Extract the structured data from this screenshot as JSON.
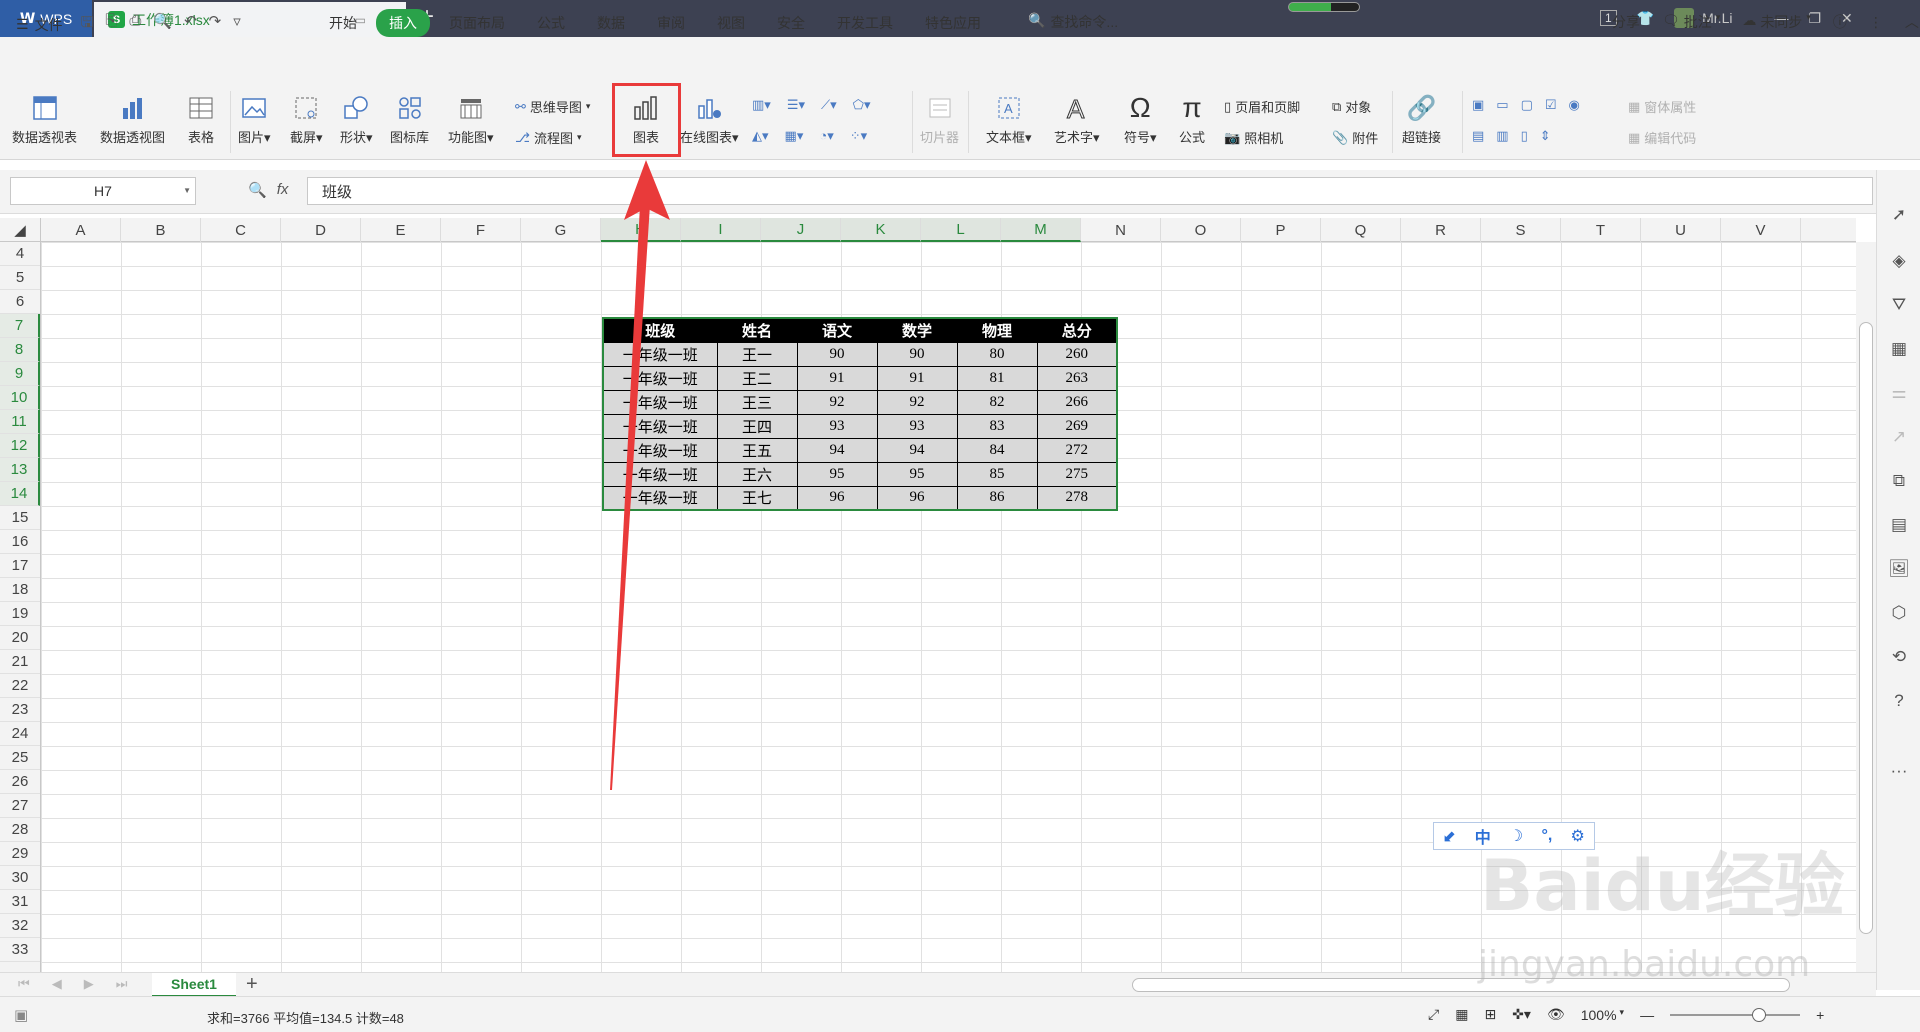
{
  "titlebar": {
    "app_tab": "WPS",
    "doc_tab": "工作簿1.xlsx",
    "window_count": "1",
    "user": "Mr.Li"
  },
  "menu": {
    "file": "文件",
    "tabs": [
      "开始",
      "插入",
      "页面布局",
      "公式",
      "数据",
      "审阅",
      "视图",
      "安全",
      "开发工具",
      "特色应用"
    ],
    "active_tab": "插入",
    "search": "查找命令...",
    "share": "分享",
    "comment": "批注",
    "sync": "未同步"
  },
  "ribbon": {
    "pivot_table": "数据透视表",
    "pivot_chart": "数据透视图",
    "table": "表格",
    "picture": "图片",
    "screenshot": "截屏",
    "shapes": "形状",
    "icon_lib": "图标库",
    "func_chart": "功能图",
    "mindmap": "思维导图",
    "flowchart": "流程图",
    "chart": "图表",
    "online_chart": "在线图表",
    "slicer": "切片器",
    "textbox": "文本框",
    "wordart": "艺术字",
    "symbol": "符号",
    "formula": "公式",
    "header_footer": "页眉和页脚",
    "object": "对象",
    "camera": "照相机",
    "attachment": "附件",
    "hyperlink": "超链接",
    "form_props": "窗体属性",
    "edit_code": "编辑代码"
  },
  "formula_bar": {
    "cell_ref": "H7",
    "fx": "fx",
    "content": "班级"
  },
  "columns": [
    "A",
    "B",
    "C",
    "D",
    "E",
    "F",
    "G",
    "H",
    "I",
    "J",
    "K",
    "L",
    "M",
    "N",
    "O",
    "P",
    "Q",
    "R",
    "S",
    "T",
    "U",
    "V"
  ],
  "rows": [
    "4",
    "5",
    "6",
    "7",
    "8",
    "9",
    "10",
    "11",
    "12",
    "13",
    "14",
    "15",
    "16",
    "17",
    "18",
    "19",
    "20",
    "21",
    "22",
    "23",
    "24",
    "25",
    "26",
    "27",
    "28",
    "29",
    "30",
    "31",
    "32",
    "33"
  ],
  "table": {
    "headers": [
      "班级",
      "姓名",
      "语文",
      "数学",
      "物理",
      "总分"
    ],
    "rows": [
      [
        "一年级一班",
        "王一",
        "90",
        "90",
        "80",
        "260"
      ],
      [
        "一年级一班",
        "王二",
        "91",
        "91",
        "81",
        "263"
      ],
      [
        "一年级一班",
        "王三",
        "92",
        "92",
        "82",
        "266"
      ],
      [
        "一年级一班",
        "王四",
        "93",
        "93",
        "83",
        "269"
      ],
      [
        "一年级一班",
        "王五",
        "94",
        "94",
        "84",
        "272"
      ],
      [
        "一年级一班",
        "王六",
        "95",
        "95",
        "85",
        "275"
      ],
      [
        "一年级一班",
        "王七",
        "96",
        "96",
        "86",
        "278"
      ]
    ]
  },
  "sheets": {
    "active": "Sheet1"
  },
  "status": {
    "summary": "求和=3766  平均值=134.5  计数=48",
    "zoom": "100%"
  },
  "ime": {
    "mode": "中"
  },
  "watermark": {
    "logo": "Baidu经验",
    "url": "jingyan.baidu.com"
  },
  "colors": {
    "accent": "#2aa24a",
    "highlight": "#e93a3a",
    "title_bg": "#3d4152"
  }
}
